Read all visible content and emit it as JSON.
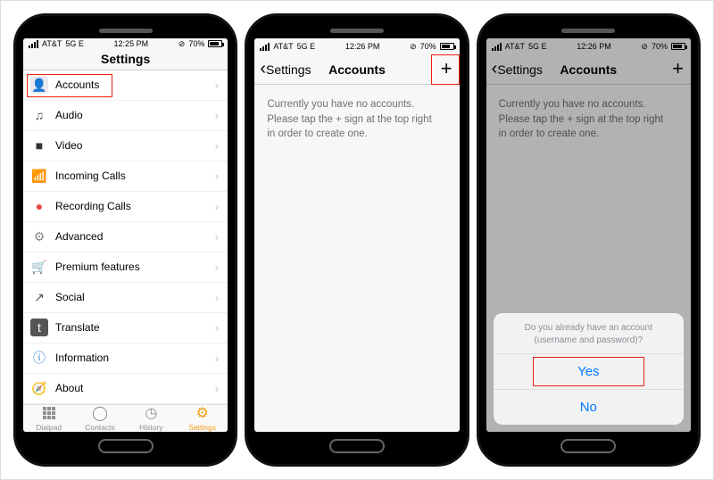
{
  "status": {
    "carrier": "AT&T",
    "net": "5G E",
    "time1": "12:25 PM",
    "time23": "12:26 PM",
    "batt": "70%"
  },
  "screen1": {
    "title": "Settings",
    "items": [
      {
        "label": "Accounts"
      },
      {
        "label": "Audio"
      },
      {
        "label": "Video"
      },
      {
        "label": "Incoming Calls"
      },
      {
        "label": "Recording Calls"
      },
      {
        "label": "Advanced"
      },
      {
        "label": "Premium features"
      },
      {
        "label": "Social"
      },
      {
        "label": "Translate"
      },
      {
        "label": "Information"
      },
      {
        "label": "About"
      }
    ],
    "tabs": [
      {
        "label": "Dialpad"
      },
      {
        "label": "Contacts"
      },
      {
        "label": "History"
      },
      {
        "label": "Settings"
      }
    ]
  },
  "screen2": {
    "back": "Settings",
    "title": "Accounts",
    "msg_l1": "Currently you have no accounts.",
    "msg_l2": "Please tap the + sign at the top right",
    "msg_l3": "in order to create one."
  },
  "screen3": {
    "back": "Settings",
    "title": "Accounts",
    "msg_l1": "Currently you have no accounts.",
    "msg_l2": "Please tap the + sign at the top right",
    "msg_l3": "in order to create one.",
    "sheet_q_l1": "Do you already have an account",
    "sheet_q_l2": "(username and password)?",
    "yes": "Yes",
    "no": "No"
  }
}
